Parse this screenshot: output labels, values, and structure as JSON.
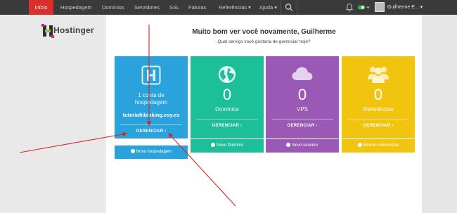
{
  "nav": {
    "items": [
      {
        "label": "Início",
        "active": true
      },
      {
        "label": "Hospedagem"
      },
      {
        "label": "Domínios"
      },
      {
        "label": "Servidores"
      },
      {
        "label": "SSL"
      },
      {
        "label": "Faturas"
      },
      {
        "label": "Referências ▾"
      },
      {
        "label": "Ajuda ▾"
      }
    ],
    "icons": [
      "search-icon",
      "bell-icon",
      "status-toggle-icon"
    ],
    "user": "Guilherme E... ▾"
  },
  "brand": {
    "name": "Hostinger"
  },
  "welcome": {
    "title": "Muito bom ver você novamente, Guilherme",
    "question": "Qual serviço você gostaria de gerenciar hoje?"
  },
  "cards": [
    {
      "id": "hosting",
      "icon": "hosting-h-icon",
      "line1": "1 conta de",
      "line2": "hospedagem",
      "domain": "tutorialtibiaking.esy.es",
      "button": "GERENCIAR ›",
      "color": "#2aa3dd",
      "action": "Nova hospedagem",
      "action_color": "#2aa3dd"
    },
    {
      "id": "domains",
      "icon": "globe-icon",
      "count": "0",
      "label": "Domínios",
      "button": "GERENCIAR ›",
      "color": "#1dbf98",
      "action": "Novo Domínio",
      "action_color": "#1dbf98"
    },
    {
      "id": "vps",
      "icon": "cloud-icon",
      "count": "0",
      "label": "VPS",
      "button": "GERENCIAR ›",
      "color": "#9b59b6",
      "action": "Novo servidor",
      "action_color": "#9b59b6"
    },
    {
      "id": "referrals",
      "icon": "people-icon",
      "count": "0",
      "label": "Referências",
      "button": "GERENCIAR ›",
      "color": "#f1c40f",
      "action": "Minhas referencias",
      "action_color": "#f1c40f"
    }
  ],
  "colors": {
    "nav_bg": "#3a3a3a",
    "nav_active": "#d9302b",
    "annotation_arrow": "#e02020"
  }
}
